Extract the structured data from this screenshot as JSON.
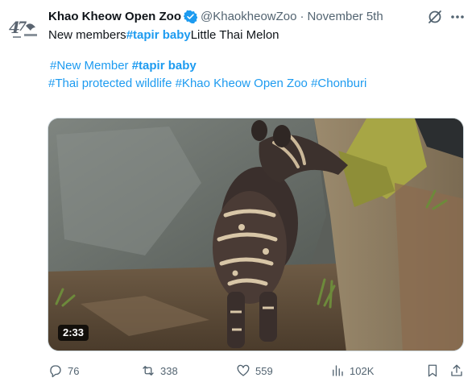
{
  "author": {
    "name": "Khao Kheow Open Zoo",
    "handle": "@KhaokheowZoo",
    "separator": "·",
    "date": "November 5th",
    "avatar_logo_text": "47"
  },
  "text": {
    "line1_prefix": "New members",
    "line1_tag": "#tapir baby",
    "line1_suffix": "Little Thai Melon",
    "line2_tag1": "#New Member",
    "line2_tag2": "#tapir baby",
    "line3_tag1": "#Thai protected wildlife",
    "line3_tag2": "#Khao Kheow Open Zoo",
    "line3_tag3": "#Chonburi"
  },
  "media": {
    "duration": "2:33",
    "description": "video"
  },
  "actions": {
    "replies": "76",
    "reposts": "338",
    "likes": "559",
    "views": "102K"
  },
  "colors": {
    "accent": "#1d9bf0",
    "text": "#0f1419",
    "muted": "#536471",
    "verified": "#1d9bf0"
  },
  "icons": {
    "verified": "verified-badge-icon",
    "grok": "grok-icon",
    "more": "more-dots-icon",
    "reply": "reply-icon",
    "repost": "repost-icon",
    "like": "heart-icon",
    "views": "views-bar-chart-icon",
    "bookmark": "bookmark-icon",
    "share": "share-icon"
  }
}
